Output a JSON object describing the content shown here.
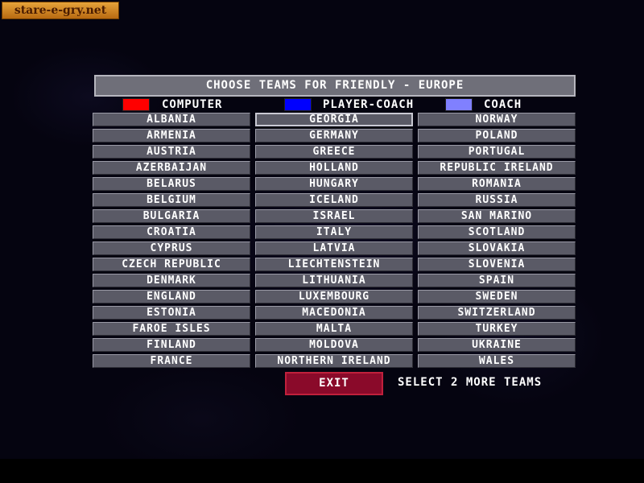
{
  "watermark": "stare-e-gry.net",
  "header": {
    "title": "CHOOSE TEAMS FOR FRIENDLY - EUROPE"
  },
  "legend": [
    {
      "label": "COMPUTER",
      "color": "#ff0000"
    },
    {
      "label": "PLAYER-COACH",
      "color": "#0000ff"
    },
    {
      "label": "COACH",
      "color": "#8080ff"
    }
  ],
  "teams": {
    "column1": [
      "ALBANIA",
      "ARMENIA",
      "AUSTRIA",
      "AZERBAIJAN",
      "BELARUS",
      "BELGIUM",
      "BULGARIA",
      "CROATIA",
      "CYPRUS",
      "CZECH REPUBLIC",
      "DENMARK",
      "ENGLAND",
      "ESTONIA",
      "FAROE ISLES",
      "FINLAND",
      "FRANCE"
    ],
    "column2": [
      "GEORGIA",
      "GERMANY",
      "GREECE",
      "HOLLAND",
      "HUNGARY",
      "ICELAND",
      "ISRAEL",
      "ITALY",
      "LATVIA",
      "LIECHTENSTEIN",
      "LITHUANIA",
      "LUXEMBOURG",
      "MACEDONIA",
      "MALTA",
      "MOLDOVA",
      "NORTHERN IRELAND"
    ],
    "column3": [
      "NORWAY",
      "POLAND",
      "PORTUGAL",
      "REPUBLIC IRELAND",
      "ROMANIA",
      "RUSSIA",
      "SAN MARINO",
      "SCOTLAND",
      "SLOVAKIA",
      "SLOVENIA",
      "SPAIN",
      "SWEDEN",
      "SWITZERLAND",
      "TURKEY",
      "UKRAINE",
      "WALES"
    ]
  },
  "footer": {
    "exit_label": "EXIT",
    "status_text": "SELECT 2 MORE TEAMS"
  }
}
